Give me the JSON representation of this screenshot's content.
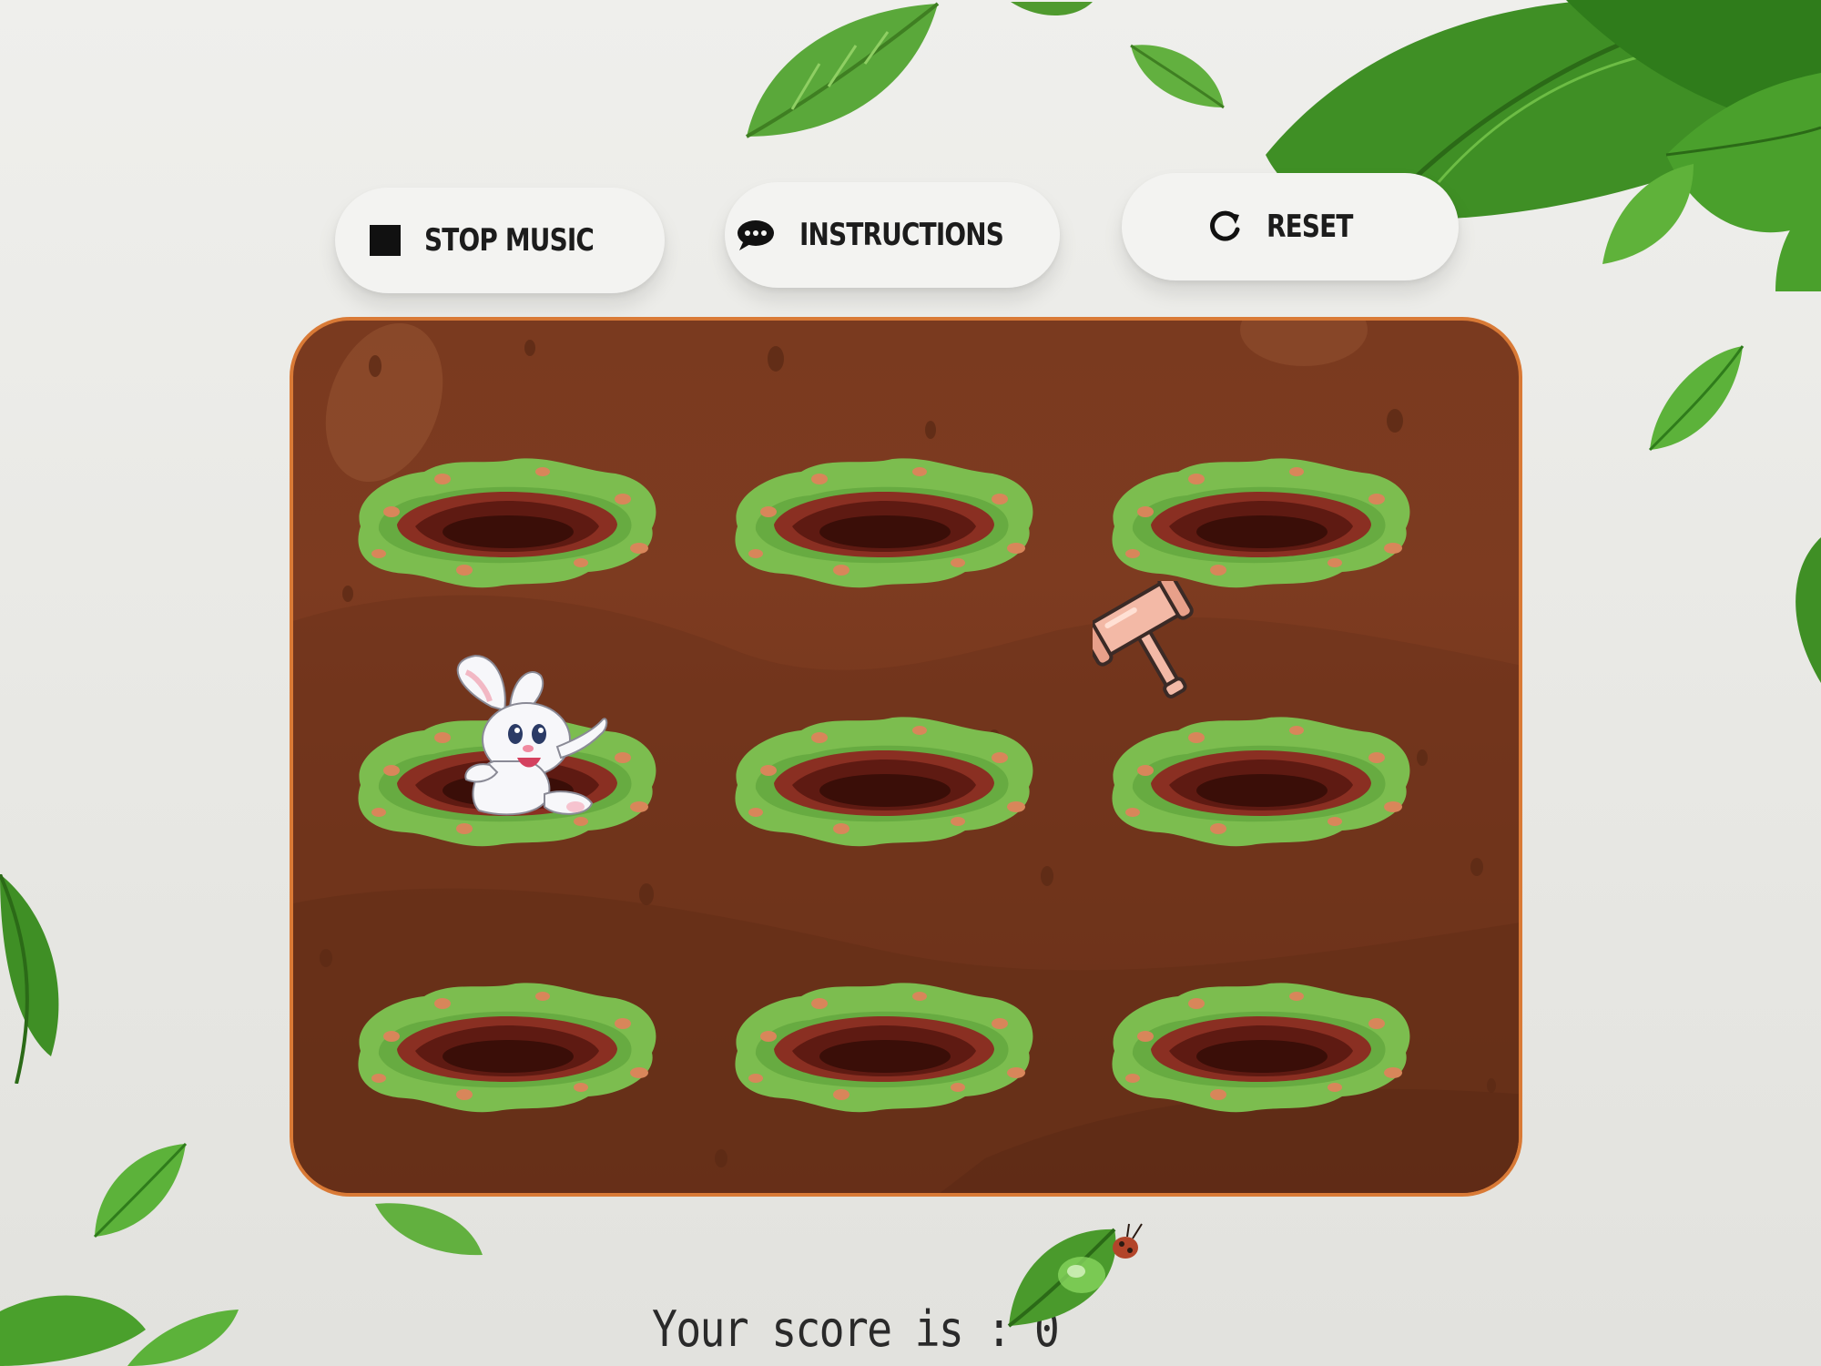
{
  "toolbar": {
    "stop_music": {
      "label": "STOP MUSIC",
      "icon": "stop-square-icon"
    },
    "instructions": {
      "label": "INSTRUCTIONS",
      "icon": "speech-bubble-icon"
    },
    "reset": {
      "label": "RESET",
      "icon": "refresh-icon"
    }
  },
  "game": {
    "holes": [
      {
        "row": 1,
        "col": 1,
        "occupant": ""
      },
      {
        "row": 1,
        "col": 2,
        "occupant": ""
      },
      {
        "row": 1,
        "col": 3,
        "occupant": ""
      },
      {
        "row": 2,
        "col": 1,
        "occupant": "bunny"
      },
      {
        "row": 2,
        "col": 2,
        "occupant": ""
      },
      {
        "row": 2,
        "col": 3,
        "occupant": ""
      },
      {
        "row": 3,
        "col": 1,
        "occupant": ""
      },
      {
        "row": 3,
        "col": 2,
        "occupant": ""
      },
      {
        "row": 3,
        "col": 3,
        "occupant": ""
      }
    ],
    "cursor": "hammer-icon"
  },
  "score": {
    "label": "Your score is : ",
    "value": "0"
  },
  "colors": {
    "soil": "#7a3a1f",
    "board_border": "#d97a36",
    "grass": "#7cbd4f",
    "leaf": "#4f9a2e"
  }
}
